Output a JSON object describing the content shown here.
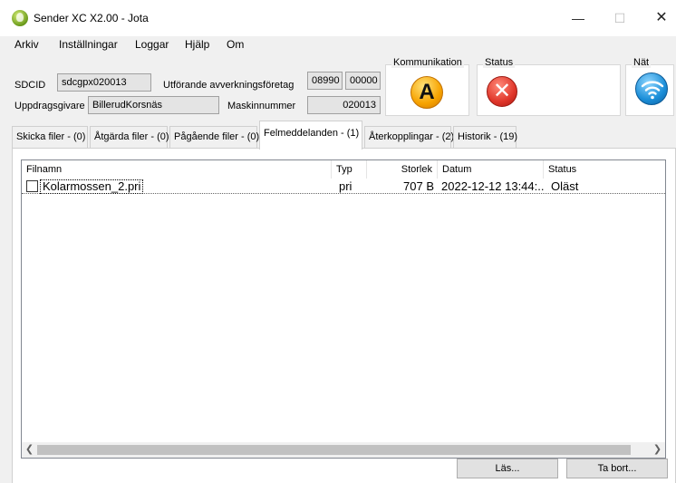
{
  "window": {
    "title": "Sender XC X2.00 - Jota",
    "min_glyph": "—",
    "max_glyph": "☐",
    "close_glyph": "✕"
  },
  "menu": [
    "Arkiv",
    "Inställningar",
    "Loggar",
    "Hjälp",
    "Om"
  ],
  "info": {
    "sdcid_label": "SDCID",
    "sdcid_value": "sdcgpx020013",
    "utforande_label": "Utförande avverkningsföretag",
    "utforande_value1": "08990",
    "utforande_value2": "00000",
    "uppdragsgivare_label": "Uppdragsgivare",
    "uppdragsgivare_value": "BillerudKorsnäs",
    "maskinnummer_label": "Maskinnummer",
    "maskinnummer_value": "020013"
  },
  "indicators": {
    "kommunikation": {
      "title": "Kommunikation",
      "glyph": "A",
      "icon": "alert-a-icon",
      "color": "#f7a300"
    },
    "status": {
      "title": "Status",
      "glyph": "✕",
      "icon": "error-x-icon",
      "color": "#e0362a"
    },
    "nat": {
      "title": "Nät",
      "icon": "wifi-icon",
      "color": "#1b8ed8"
    }
  },
  "tabs": [
    {
      "label": "Skicka filer - (0)"
    },
    {
      "label": "Åtgärda filer - (0)"
    },
    {
      "label": "Pågående filer - (0)"
    },
    {
      "label": "Felmeddelanden - (1)",
      "active": true
    },
    {
      "label": "Återkopplingar - (2)"
    },
    {
      "label": "Historik - (19)"
    }
  ],
  "table": {
    "columns": [
      "Filnamn",
      "Typ",
      "Storlek",
      "Datum",
      "Status"
    ],
    "rows": [
      {
        "checked": false,
        "filnamn": "Kolarmossen_2.pri",
        "typ": "pri",
        "storlek": "707 B",
        "datum": "2022-12-12 13:44:...",
        "status": "Oläst"
      }
    ]
  },
  "scrollbar": {
    "left_glyph": "❮",
    "right_glyph": "❯"
  },
  "buttons": {
    "las": "Läs...",
    "ta_bort": "Ta bort..."
  }
}
